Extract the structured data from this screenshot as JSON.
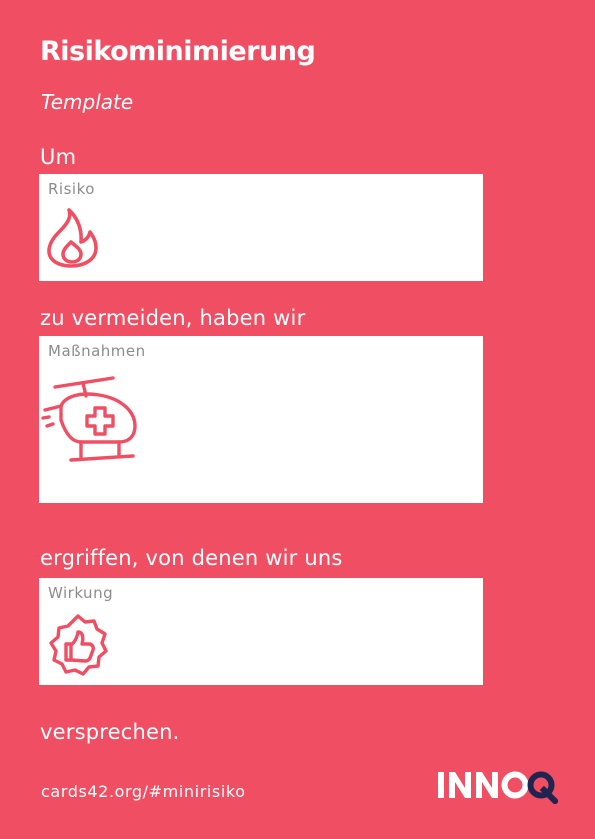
{
  "card": {
    "title": "Risikominimierung",
    "subtitle": "Template"
  },
  "prompts": {
    "intro": "Um",
    "after_risk": "zu vermeiden, haben wir",
    "after_measures": "ergriffen, von denen wir uns",
    "outro": "versprechen."
  },
  "fields": {
    "risk": {
      "label": "Risiko",
      "icon": "flame-icon"
    },
    "measures": {
      "label": "Maßnahmen",
      "icon": "rescue-helicopter-icon"
    },
    "effect": {
      "label": "Wirkung",
      "icon": "thumbs-up-badge-icon"
    }
  },
  "footer": {
    "link": "cards42.org/#minirisiko",
    "logo_text": "INNOQ"
  },
  "colors": {
    "background": "#f04e62",
    "box": "#ffffff",
    "label": "#8c8c8c",
    "icon": "#f04e62",
    "logo_accent": "#1f2550"
  }
}
